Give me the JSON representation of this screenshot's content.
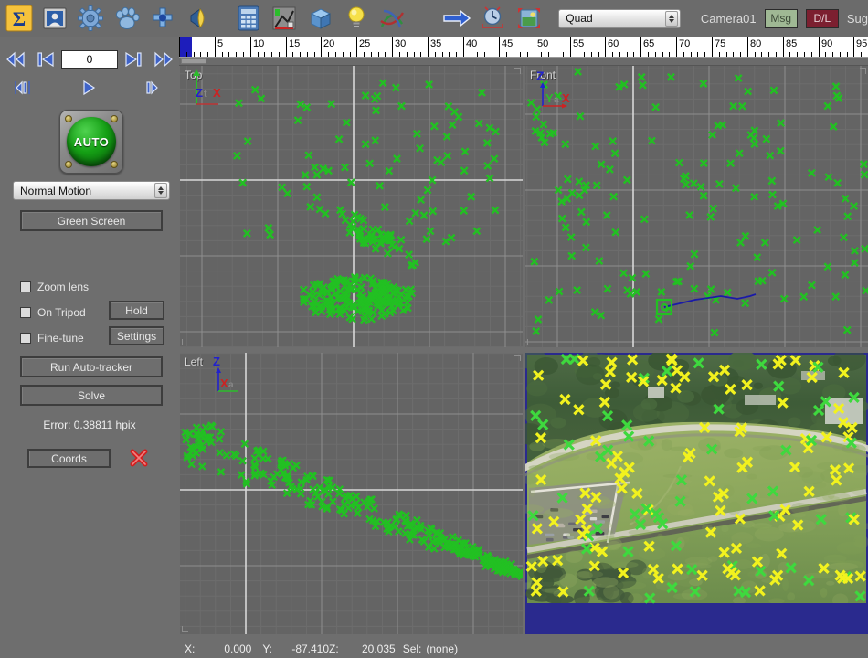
{
  "toolbar": {
    "icons": [
      {
        "name": "sigma-summary-icon",
        "glyph": "Σ"
      },
      {
        "name": "image-preferences-icon",
        "glyph": ""
      },
      {
        "name": "gear-settings-icon",
        "glyph": ""
      },
      {
        "name": "paw-tracker-icon",
        "glyph": ""
      },
      {
        "name": "perspective-add-icon",
        "glyph": ""
      },
      {
        "name": "lens-cap-icon",
        "glyph": ""
      },
      {
        "name": "spreadsheet-icon",
        "glyph": ""
      },
      {
        "name": "graph-editor-icon",
        "glyph": ""
      },
      {
        "name": "3d-cube-icon",
        "glyph": ""
      },
      {
        "name": "lightbulb-icon",
        "glyph": ""
      },
      {
        "name": "mesh-shapes-icon",
        "glyph": ""
      },
      {
        "name": "blue-arrow-icon",
        "glyph": ""
      },
      {
        "name": "timeline-clock-icon",
        "glyph": ""
      },
      {
        "name": "region-marker-icon",
        "glyph": ""
      }
    ],
    "view_select": {
      "value": "Quad"
    },
    "camera_label": "Camera01",
    "badge_msg": "Msg",
    "badge_dl": "D/L",
    "suggestion_label": "Sug"
  },
  "sidebar": {
    "nav_row1": [
      "rewind-all",
      "rewind-key",
      "frame-field",
      "forward-key",
      "forward-all"
    ],
    "nav_row2": [
      "step-back",
      "play",
      "step-forward"
    ],
    "frame_value": "0",
    "auto_button_label": "AUTO",
    "motion_select": {
      "value": "Normal Motion"
    },
    "green_screen_label": "Green Screen",
    "checkboxes": [
      {
        "label": "Zoom lens",
        "checked": false
      },
      {
        "label": "On Tripod",
        "checked": false
      },
      {
        "label": "Fine-tune",
        "checked": false
      }
    ],
    "hold_label": "Hold",
    "settings_label": "Settings",
    "run_tracker_label": "Run Auto-tracker",
    "solve_label": "Solve",
    "error_text": "Error: 0.38811 hpix",
    "coords_label": "Coords",
    "delete_icon": "red-x-delete-icon"
  },
  "ruler": {
    "start": 0,
    "end": 97,
    "major_step": 5,
    "minor_step": 1,
    "labels": [
      "5",
      "10",
      "15",
      "20",
      "25",
      "30",
      "35",
      "40",
      "45",
      "50",
      "55",
      "60",
      "65",
      "70",
      "75",
      "80",
      "85",
      "90",
      "95"
    ],
    "playhead_frame": 0
  },
  "viewports": [
    {
      "name": "top",
      "label": "Top",
      "gizmo": [
        {
          "axis": "Y",
          "color": "#2bbd2b",
          "dir": "up"
        },
        {
          "axis": "Z",
          "color": "#2222cc",
          "dir": "label"
        },
        {
          "axis": "X",
          "color": "#cc2222",
          "dir": "right"
        }
      ],
      "point_color": "#22c022",
      "grid_color": "#757575",
      "axis_color": "#c8c8c8",
      "background": "#646464"
    },
    {
      "name": "front",
      "label": "Front",
      "gizmo": [
        {
          "axis": "Z",
          "color": "#2222cc",
          "dir": "up"
        },
        {
          "axis": "Y",
          "color": "#2bbd2b",
          "dir": "label"
        },
        {
          "axis": "X",
          "color": "#cc2222",
          "dir": "right"
        }
      ],
      "point_color": "#22c022",
      "path_color": "#1a1aa8",
      "background": "#646464"
    },
    {
      "name": "left",
      "label": "Left",
      "gizmo": [
        {
          "axis": "Z",
          "color": "#2222cc",
          "dir": "up"
        },
        {
          "axis": "X",
          "color": "#cc2222",
          "dir": "label"
        },
        {
          "axis": "Y",
          "color": "#2bbd2b",
          "dir": "right"
        }
      ],
      "point_color": "#22c022",
      "background": "#646464"
    },
    {
      "name": "camera",
      "label": "",
      "description": "aerial photo of grass sports field with running track, trees and parking lot",
      "tracker_colors": [
        "#f2f21e",
        "#3ed93e"
      ],
      "border_color": "#2a2a8e"
    }
  ],
  "status": {
    "x_label": "X:",
    "x_value": "0.000",
    "y_label": "Y:",
    "y_value": "-87.410",
    "z_label": "Z:",
    "z_value": "20.035",
    "sel_label": "Sel:",
    "sel_value": "(none)"
  },
  "colors": {
    "chrome": "#6e6e6e",
    "viewport_bg": "#646464",
    "marker_green": "#22c022",
    "marker_yellow": "#f2f21e",
    "accent_blue": "#1d1dbb"
  }
}
